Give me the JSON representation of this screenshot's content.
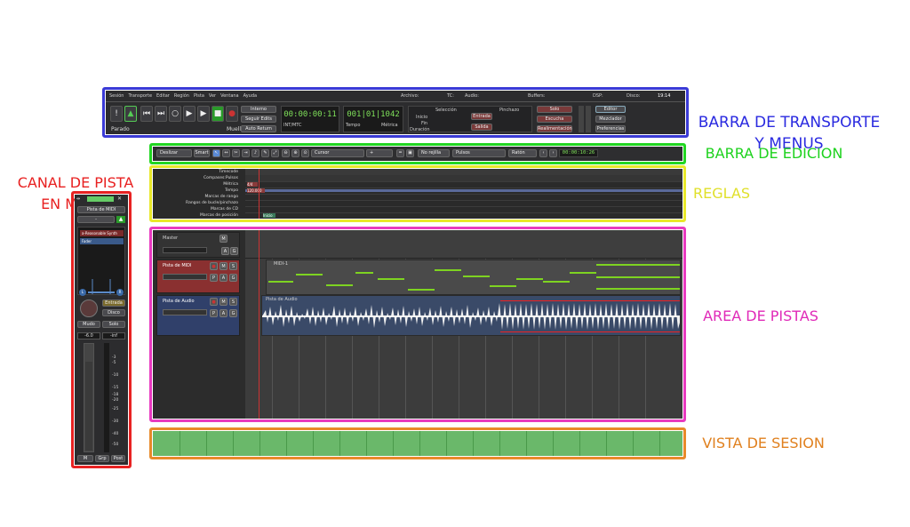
{
  "labels": {
    "transport": "BARRA DE TRANSPORTE\nY MENUS",
    "edit": "BARRA DE EDICION",
    "rulers": "REGLAS",
    "tracks": "AREA DE PISTAS",
    "session": "VISTA DE SESION",
    "mixer": "CANAL DE PISTA\nEN MIXER"
  },
  "colors": {
    "transport": "#3a3ad6",
    "edit": "#22d622",
    "rulers": "#e8e82a",
    "tracks": "#e83ac0",
    "session": "#e88a2a",
    "mixer": "#e82222"
  },
  "menu": [
    "Sesión",
    "Transporte",
    "Editar",
    "Región",
    "Pista",
    "Ver",
    "Ventana",
    "Ayuda"
  ],
  "status": {
    "archivo": "Archivo:",
    "tc": "TC:",
    "audio": "Audio:",
    "buffers": "Buffers:",
    "dsp": "DSP:",
    "disco": "Disco:",
    "time": "19:14"
  },
  "transport": {
    "state": "Parado",
    "muelle": "Muelle",
    "interno": "Interno",
    "seguir": "Seguir Edits",
    "autoreturn": "Auto Return",
    "clock1": "00:00:00:11",
    "intmtc": "INT/MTC",
    "clock2": "001|01|1042",
    "tempo": "Tempo",
    "metrica": "Métrica",
    "seleccion": "Selección",
    "pinchazo": "Pinchazo",
    "inicio": "Inicio",
    "fin": "Fin",
    "duracion": "Duración",
    "entrada": "Entrada",
    "salida": "Salida",
    "solo": "Solo",
    "escucha": "Escucha",
    "realimentacion": "Realimentación",
    "editor": "Editor",
    "mezclador": "Mezclador",
    "preferencias": "Preferencias"
  },
  "editbar": {
    "mode": "Deslizar",
    "smart": "Smart",
    "cursor": "Cursor",
    "plus": "+",
    "noregla": "No rejilla",
    "pulsos": "Pulsos",
    "raton": "Ratón",
    "nudgeclock": "00:00:10:26"
  },
  "rulers": [
    "Timecode",
    "Compases:Pulsos",
    "Métrica",
    "Tempo",
    "Marcas de rango",
    "Rangos de bucle/pinchazo",
    "Marcas de CD",
    "Marcas de posición"
  ],
  "ruler_tempo": "4/4",
  "ruler_tempo_val": "120.000",
  "ruler_start": "Inicio",
  "tracks": {
    "master": "Master",
    "midi": "Pista de MIDI",
    "audio": "Pista de Audio",
    "midi_region": "MIDI-1",
    "audio_region": "Pista de Audio",
    "m": "M",
    "s": "S",
    "a": "A",
    "g": "G",
    "p": "P"
  },
  "mixer": {
    "name": "Pista de MIDI",
    "plugin": "a-Reasonable Synth",
    "fader": "Fader",
    "entrada": "Entrada",
    "disco": "Disco",
    "mudo": "Mudo",
    "solo": "Solo",
    "gain": "-6.0",
    "peak": "-inf",
    "m": "M",
    "grp": "Grp",
    "post": "Post",
    "l": "L",
    "r": "R",
    "scale": [
      "-3",
      "-5",
      "-10",
      "-15",
      "-18",
      "-20",
      "-25",
      "-30",
      "-40",
      "-50"
    ]
  }
}
